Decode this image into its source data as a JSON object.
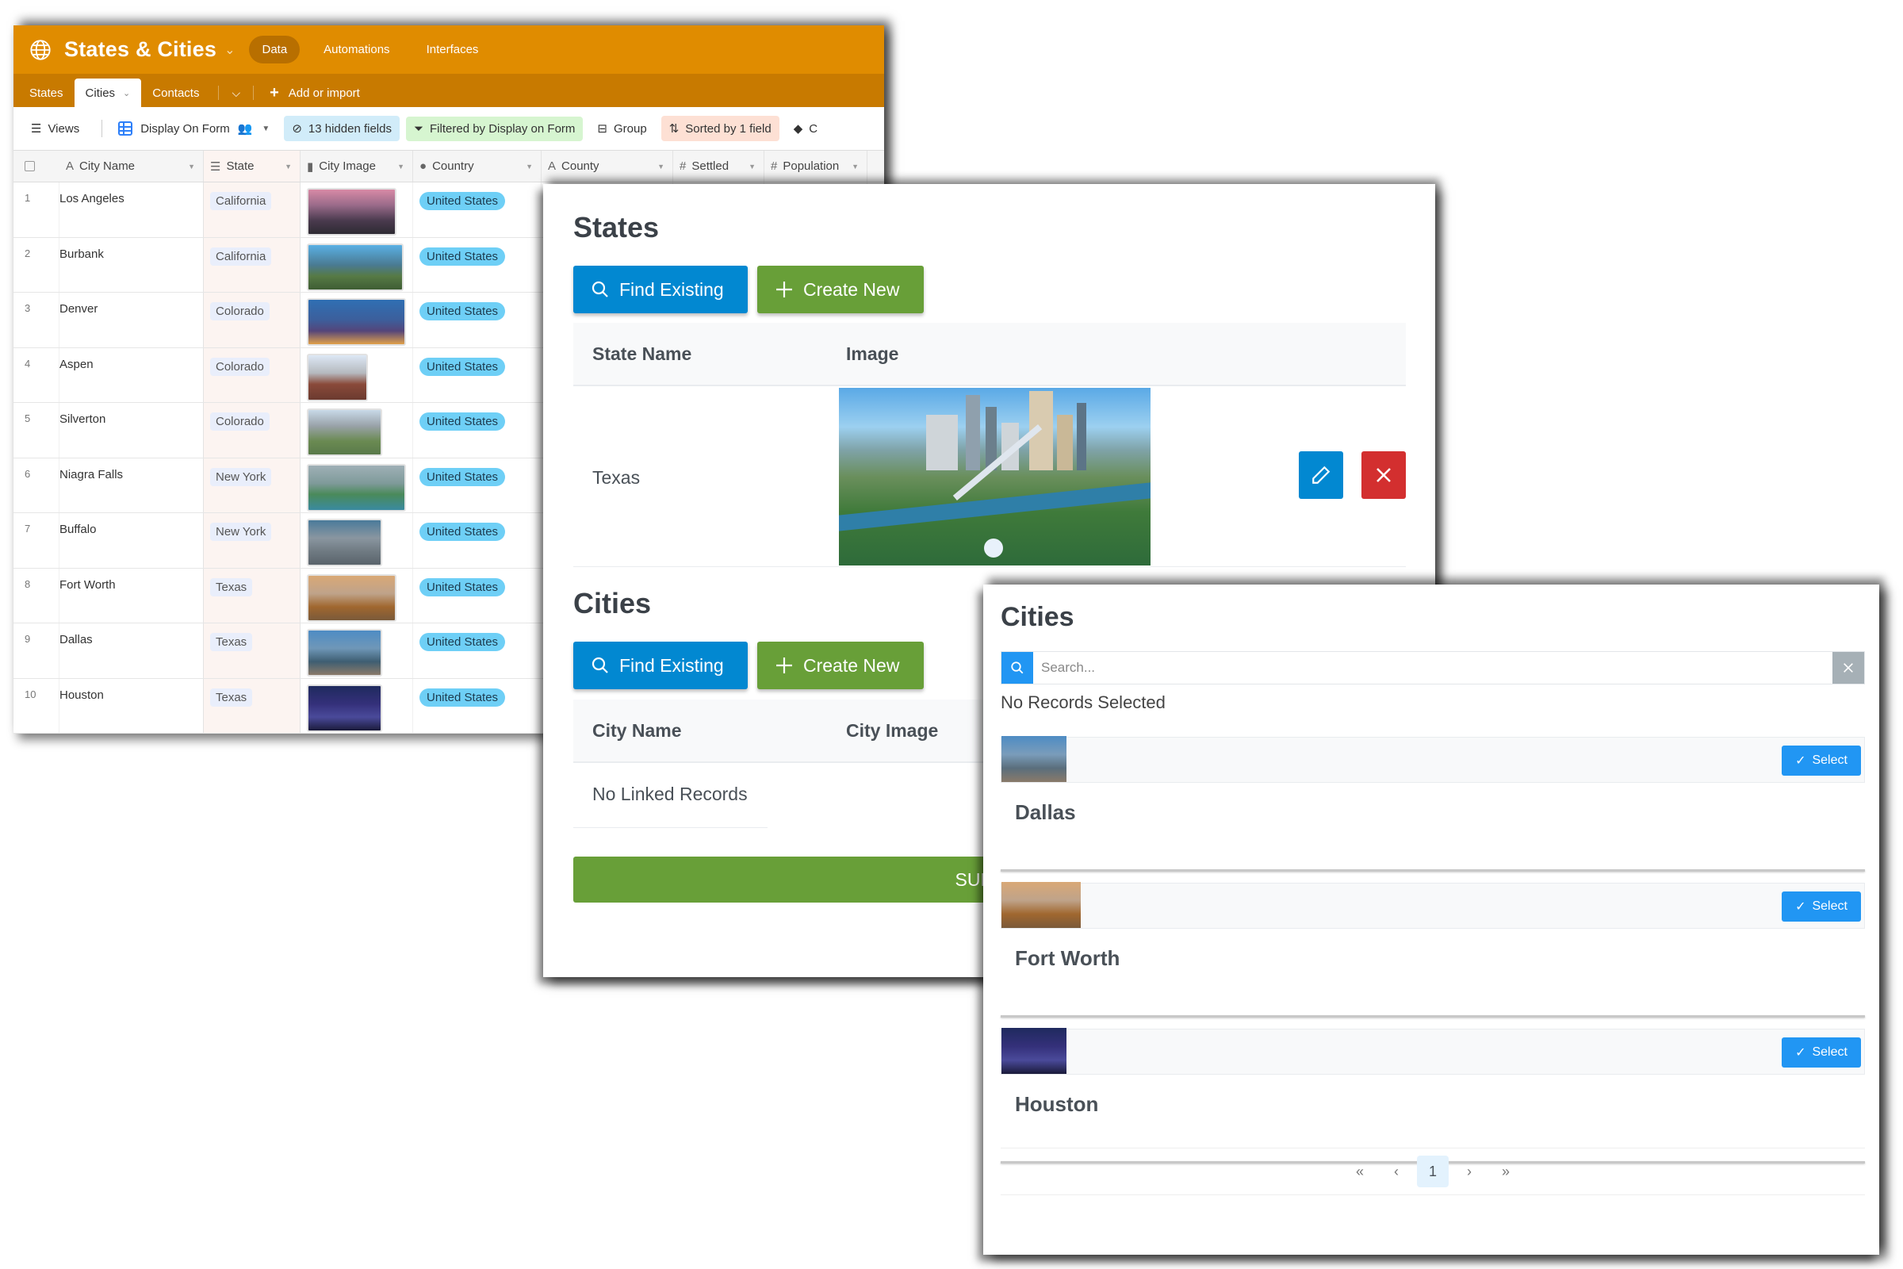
{
  "airtable": {
    "base_title": "States & Cities",
    "nav": [
      "Data",
      "Automations",
      "Interfaces"
    ],
    "active_nav": "Data",
    "tabs": [
      {
        "label": "States",
        "active": false
      },
      {
        "label": "Cities",
        "active": true
      },
      {
        "label": "Contacts",
        "active": false
      }
    ],
    "add_import_label": "Add or import",
    "toolbar": {
      "views_label": "Views",
      "view_name": "Display On Form",
      "hidden_fields": "13 hidden fields",
      "filter": "Filtered by Display on Form",
      "group": "Group",
      "sort": "Sorted by 1 field",
      "color_partial": "C"
    },
    "columns": [
      {
        "label": "City Name",
        "icon": "text-icon"
      },
      {
        "label": "State",
        "icon": "link-icon"
      },
      {
        "label": "City Image",
        "icon": "attachment-icon"
      },
      {
        "label": "Country",
        "icon": "single-select-icon"
      },
      {
        "label": "County",
        "icon": "text-icon"
      },
      {
        "label": "Settled",
        "icon": "number-icon"
      },
      {
        "label": "Population",
        "icon": "number-icon"
      }
    ],
    "rows": [
      {
        "num": "1",
        "city": "Los Angeles",
        "state": "California",
        "country": "United States"
      },
      {
        "num": "2",
        "city": "Burbank",
        "state": "California",
        "country": "United States"
      },
      {
        "num": "3",
        "city": "Denver",
        "state": "Colorado",
        "country": "United States"
      },
      {
        "num": "4",
        "city": "Aspen",
        "state": "Colorado",
        "country": "United States"
      },
      {
        "num": "5",
        "city": "Silverton",
        "state": "Colorado",
        "country": "United States"
      },
      {
        "num": "6",
        "city": "Niagra Falls",
        "state": "New York",
        "country": "United States"
      },
      {
        "num": "7",
        "city": "Buffalo",
        "state": "New York",
        "country": "United States"
      },
      {
        "num": "8",
        "city": "Fort Worth",
        "state": "Texas",
        "country": "United States"
      },
      {
        "num": "9",
        "city": "Dallas",
        "state": "Texas",
        "country": "United States"
      },
      {
        "num": "10",
        "city": "Houston",
        "state": "Texas",
        "country": "United States"
      }
    ]
  },
  "form": {
    "states_section": {
      "title": "States",
      "find_existing": "Find Existing",
      "create_new": "Create New",
      "headers": [
        "State Name",
        "Image"
      ],
      "record": {
        "name": "Texas"
      }
    },
    "cities_section": {
      "title": "Cities",
      "find_existing": "Find Existing",
      "create_new": "Create New",
      "headers": [
        "City Name",
        "City Image"
      ],
      "empty_text": "No Linked Records"
    },
    "submit_label": "SUBMIT"
  },
  "picker": {
    "title": "Cities",
    "search_placeholder": "Search...",
    "search_value": "",
    "status": "No Records Selected",
    "select_label": "Select",
    "cards": [
      {
        "name": "Dallas"
      },
      {
        "name": "Fort Worth"
      },
      {
        "name": "Houston"
      }
    ],
    "pagination": {
      "first": "«",
      "prev": "‹",
      "current": "1",
      "next": "›",
      "last": "»"
    }
  },
  "colors": {
    "airtable_header": "#e08c00",
    "airtable_tabbar": "#c87a00",
    "primary_blue": "#0288d1",
    "success_green": "#689f38",
    "danger_red": "#d32f2f",
    "picker_blue": "#2196f3",
    "country_chip": "#6ecff6"
  }
}
